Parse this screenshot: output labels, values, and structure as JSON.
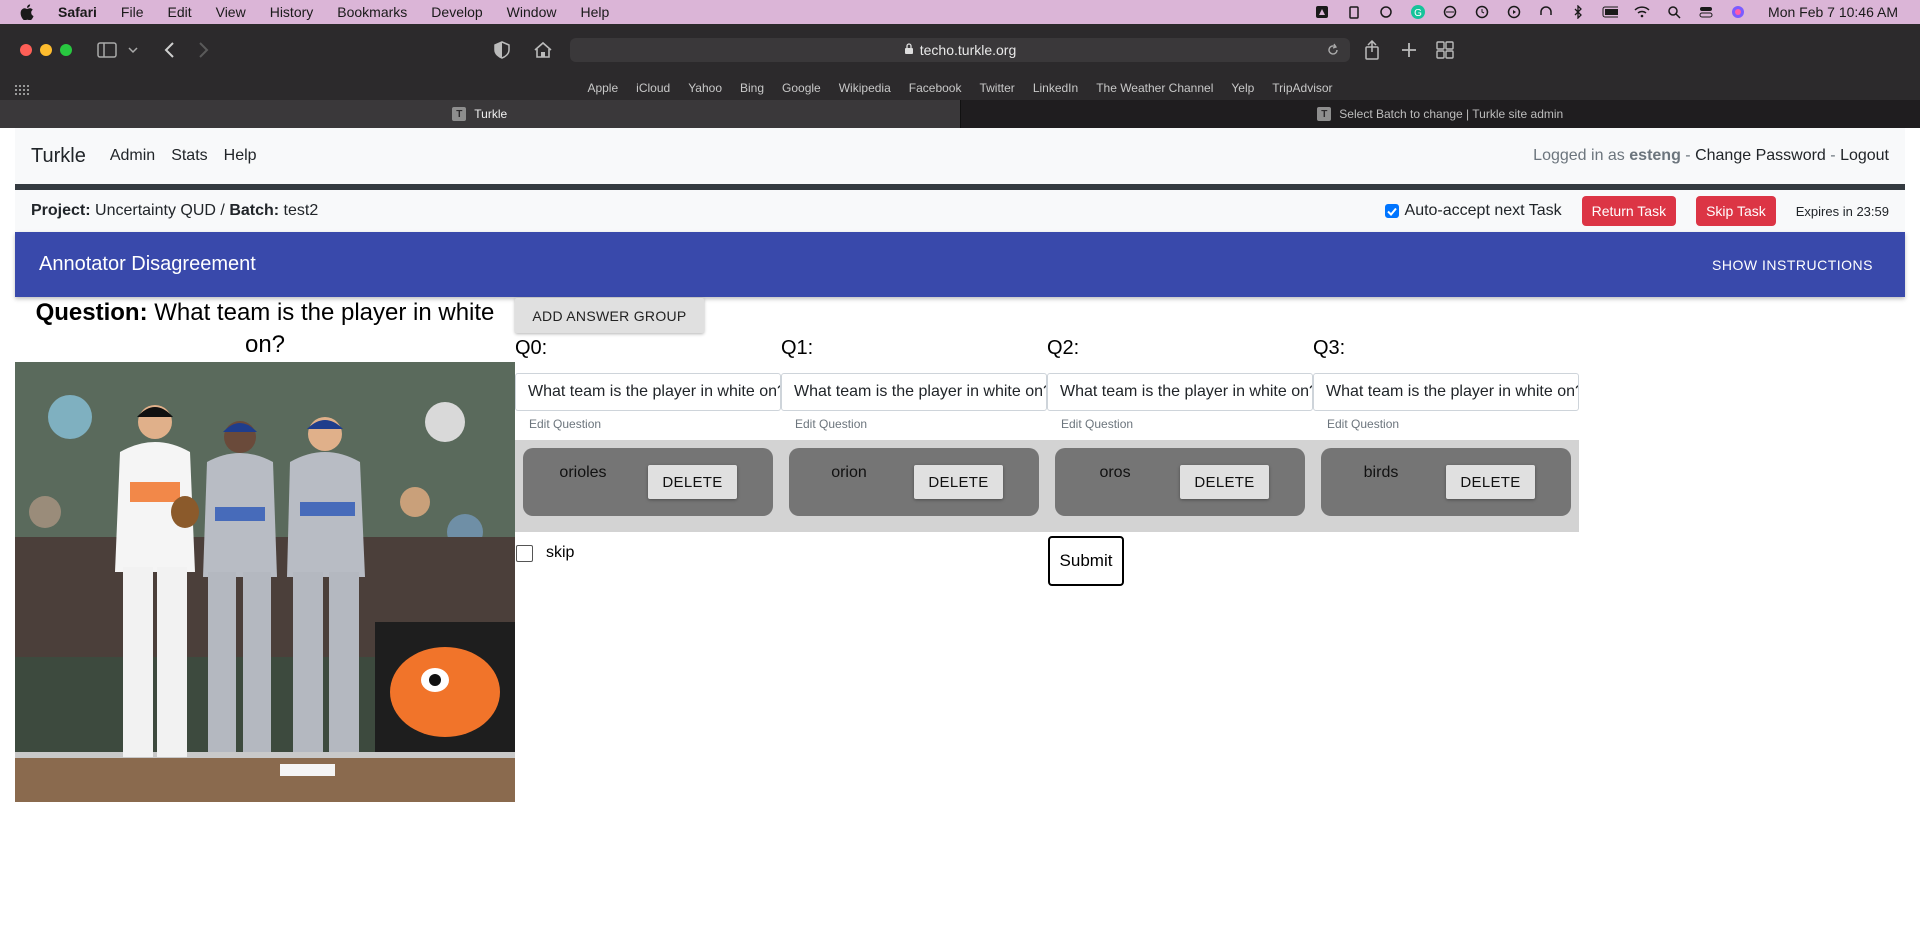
{
  "menubar": {
    "app": "Safari",
    "items": [
      "File",
      "Edit",
      "View",
      "History",
      "Bookmarks",
      "Develop",
      "Window",
      "Help"
    ],
    "clock": "Mon Feb 7  10:46 AM"
  },
  "browser": {
    "url": "techo.turkle.org",
    "favorites": [
      "Apple",
      "iCloud",
      "Yahoo",
      "Bing",
      "Google",
      "Wikipedia",
      "Facebook",
      "Twitter",
      "LinkedIn",
      "The Weather Channel",
      "Yelp",
      "TripAdvisor"
    ],
    "tabs": [
      {
        "label": "Turkle",
        "favicon": "T"
      },
      {
        "label": "Select Batch to change | Turkle site admin",
        "favicon": "T"
      }
    ]
  },
  "navbar": {
    "brand": "Turkle",
    "links": [
      "Admin",
      "Stats",
      "Help"
    ],
    "logged_in_prefix": "Logged in as",
    "username": "esteng",
    "sep": "-",
    "change_password": "Change Password",
    "logout": "Logout"
  },
  "project": {
    "project_label": "Project:",
    "project_name": "Uncertainty QUD",
    "slash": "/",
    "batch_label": "Batch:",
    "batch_name": "test2",
    "auto_accept": "Auto-accept next Task",
    "return_task": "Return Task",
    "skip_task": "Skip Task",
    "expires": "Expires in 23:59"
  },
  "header": {
    "title": "Annotator Disagreement",
    "show_instructions": "SHOW INSTRUCTIONS"
  },
  "question": {
    "label": "Question:",
    "text": "What team is the player in white on?"
  },
  "add_answer_group": "ADD ANSWER GROUP",
  "columns": [
    {
      "label": "Q0:",
      "input_value": "What team is the player in white on?",
      "edit": "Edit Question",
      "answer": "orioles",
      "delete": "DELETE"
    },
    {
      "label": "Q1:",
      "input_value": "What team is the player in white on?",
      "edit": "Edit Question",
      "answer": "orion",
      "delete": "DELETE"
    },
    {
      "label": "Q2:",
      "input_value": "What team is the player in white on?",
      "edit": "Edit Question",
      "answer": "oros",
      "delete": "DELETE"
    },
    {
      "label": "Q3:",
      "input_value": "What team is the player in white on?",
      "edit": "Edit Question",
      "answer": "birds",
      "delete": "DELETE"
    }
  ],
  "skip": {
    "label": "skip",
    "checked": false
  },
  "submit": "Submit",
  "colors": {
    "header_blue": "#3949ab",
    "danger": "#dc3545",
    "group_bg": "#d3d3d3",
    "group_inner": "#757575",
    "menubar": "#dbb5d7"
  }
}
